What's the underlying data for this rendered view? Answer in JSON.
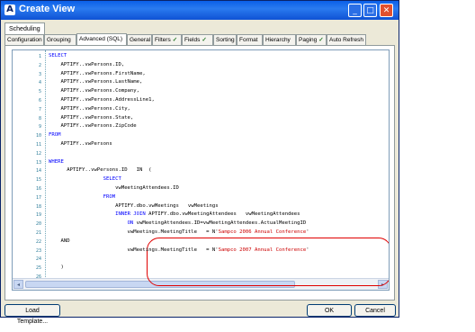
{
  "window": {
    "title": "Create View",
    "app_icon": "A"
  },
  "top_tabs": [
    "Scheduling"
  ],
  "tabs": [
    {
      "label": "Configuration",
      "check": false
    },
    {
      "label": "Grouping",
      "check": false
    },
    {
      "label": "Advanced (SQL)",
      "check": false,
      "active": true
    },
    {
      "label": "General",
      "check": false
    },
    {
      "label": "Filters",
      "check": true
    },
    {
      "label": "Fields",
      "check": true
    },
    {
      "label": "Sorting",
      "check": false
    },
    {
      "label": "Format",
      "check": false
    },
    {
      "label": "Hierarchy",
      "check": false
    },
    {
      "label": "Paging",
      "check": true
    },
    {
      "label": "Auto Refresh",
      "check": false
    }
  ],
  "sql_lines": [
    [
      {
        "t": "SELECT",
        "k": "kw"
      }
    ],
    [
      {
        "t": "    APTIFY..vwPersons.ID,"
      }
    ],
    [
      {
        "t": "    APTIFY..vwPersons.FirstName,"
      }
    ],
    [
      {
        "t": "    APTIFY..vwPersons.LastName,"
      }
    ],
    [
      {
        "t": "    APTIFY..vwPersons.Company,"
      }
    ],
    [
      {
        "t": "    APTIFY..vwPersons.AddressLine1,"
      }
    ],
    [
      {
        "t": "    APTIFY..vwPersons.City,"
      }
    ],
    [
      {
        "t": "    APTIFY..vwPersons.State,"
      }
    ],
    [
      {
        "t": "    APTIFY..vwPersons.ZipCode"
      }
    ],
    [
      {
        "t": "FROM",
        "k": "kw"
      }
    ],
    [
      {
        "t": "    APTIFY..vwPersons"
      }
    ],
    [
      {
        "t": ""
      }
    ],
    [
      {
        "t": "WHERE",
        "k": "kw"
      }
    ],
    [
      {
        "t": "      APTIFY..vwPersons.ID   IN  ("
      }
    ],
    [
      {
        "t": "                  "
      },
      {
        "t": "SELECT",
        "k": "kw"
      }
    ],
    [
      {
        "t": "                      vwMeetingAttendees.ID"
      }
    ],
    [
      {
        "t": "                  "
      },
      {
        "t": "FROM",
        "k": "kw"
      }
    ],
    [
      {
        "t": "                      APTIFY.dbo.vwMeetings   vwMeetings"
      }
    ],
    [
      {
        "t": "                      "
      },
      {
        "t": "INNER JOIN",
        "k": "kw"
      },
      {
        "t": " APTIFY.dbo.vwMeetingAttendees   vwMeetingAttendees"
      }
    ],
    [
      {
        "t": "                          "
      },
      {
        "t": "ON",
        "k": "kw"
      },
      {
        "t": " vwMeetingAttendees.ID=vwMeetingAttendees.ActualMeetingID"
      }
    ],
    [
      {
        "t": "                          vwMeetings.MeetingTitle   = N'"
      },
      {
        "t": "Sampco 2006 Annual Conference",
        "k": "str"
      },
      {
        "t": "'"
      }
    ],
    [
      {
        "t": "    AND"
      }
    ],
    [
      {
        "t": "                          vwMeetings.MeetingTitle   = N'"
      },
      {
        "t": "Sampco 2007 Annual Conference",
        "k": "str"
      },
      {
        "t": "'"
      }
    ],
    [
      {
        "t": ""
      }
    ],
    [
      {
        "t": "    )"
      }
    ],
    [
      {
        "t": ""
      }
    ]
  ],
  "line_numbers": [
    "1",
    "2",
    "3",
    "4",
    "5",
    "6",
    "7",
    "8",
    "9",
    "10",
    "11",
    "12",
    "13",
    "14",
    "15",
    "16",
    "17",
    "18",
    "19",
    "20",
    "21",
    "22",
    "23",
    "24",
    "25",
    "26"
  ],
  "buttons": {
    "load_template": "Load Template...",
    "ok": "OK",
    "cancel": "Cancel"
  }
}
